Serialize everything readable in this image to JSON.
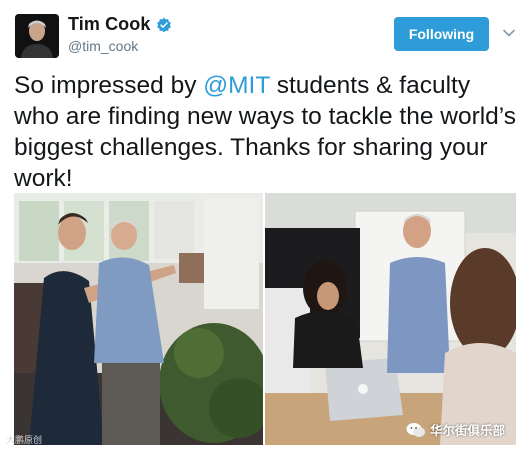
{
  "tweet": {
    "author": {
      "display_name": "Tim Cook",
      "handle": "@tim_cook",
      "verified": true
    },
    "follow_button_label": "Following",
    "text_before": "So impressed by ",
    "mention": "@MIT",
    "text_after": " students & faculty who are finding new ways to tackle the world’s biggest challenges. Thanks for sharing your work!",
    "media": [
      {
        "name": "photo-left",
        "watermark": "大鹏原创"
      },
      {
        "name": "photo-right",
        "watermark": "华尔街俱乐部"
      }
    ]
  },
  "colors": {
    "accent": "#2d9cd8",
    "text": "#14171a",
    "secondary": "#657786"
  },
  "icons": [
    "verified-badge-icon",
    "chevron-down-icon",
    "wechat-icon"
  ]
}
